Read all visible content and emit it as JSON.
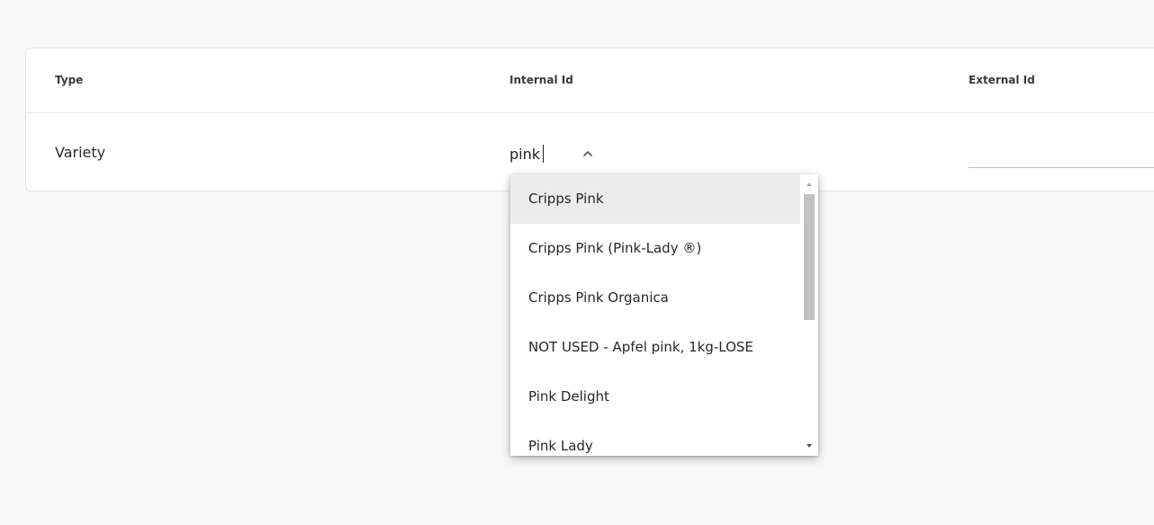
{
  "table": {
    "headers": {
      "type": "Type",
      "internal_id": "Internal Id",
      "external_id": "External Id"
    },
    "row": {
      "type": "Variety",
      "internal_id_input": "pink",
      "external_id_input": ""
    }
  },
  "dropdown": {
    "options": [
      "Cripps Pink",
      "Cripps Pink (Pink-Lady ®)",
      "Cripps Pink Organica",
      "NOT USED - Apfel pink, 1kg-LOSE",
      "Pink Delight",
      "Pink Lady"
    ],
    "highlighted_option": "Cripps Pink"
  },
  "icons": {
    "dropdown_toggle": "chevron-up-icon",
    "scroll_up": "scroll-up-arrow-icon",
    "scroll_down": "scroll-down-arrow-icon"
  }
}
